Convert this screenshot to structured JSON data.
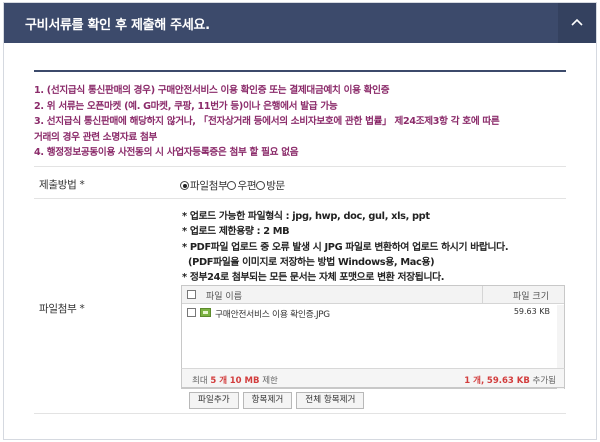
{
  "header": {
    "title": "구비서류를 확인 후 제출해 주세요."
  },
  "notices": [
    "1. (선지급식 통신판매의 경우) 구매안전서비스 이용 확인증 또는 결제대금예치 이용 확인증",
    "2. 위 서류는 오픈마켓 (예. G마켓, 쿠팡, 11번가 등)이나 은행에서 발급 가능",
    "3. 선지급식 통신판매에 해당하지 않거나, 「전자상거래 등에서의 소비자보호에 관한 법률」 제24조제3항 각 호에 따른",
    "거래의 경우 관련 소명자료 첨부",
    "4. 행정정보공동이용 사전동의 시 사업자등록증은 첨부 할 필요 없음"
  ],
  "submit_method": {
    "label": "제출방법 *",
    "options": [
      "파일첨부",
      "우편",
      "방문"
    ],
    "selected": "파일첨부"
  },
  "attachment": {
    "label": "파일첨부 *",
    "guide": [
      "* 업로드 가능한 파일형식 : jpg, hwp, doc, gul, xls, ppt",
      "* 업로드 제한용량 : 2 MB",
      "* PDF파일 업로드 중 오류 발생 시 JPG 파일로 변환하여 업로드 하시기 바랍니다.",
      "(PDF파일을 이미지로 저장하는 방법  Windows용, Mac용)",
      "* 정부24로 첨부되는 모든 문서는 자체 포맷으로 변환 저장됩니다."
    ],
    "columns": {
      "name": "파일 이름",
      "size": "파일 크기"
    },
    "files": [
      {
        "name": "구매안전서비스 이용 확인증.JPG",
        "size": "59.63 KB",
        "icon": "jpg-file-icon"
      }
    ],
    "limit": {
      "prefix": "최대",
      "count": "5 개",
      "size": "10 MB",
      "suffix": "제한"
    },
    "status": {
      "count": "1 개,",
      "size": "59.63 KB",
      "suffix": "추가됨"
    },
    "buttons": {
      "add": "파일추가",
      "remove": "항목제거",
      "remove_all": "전체 항목제거"
    }
  }
}
